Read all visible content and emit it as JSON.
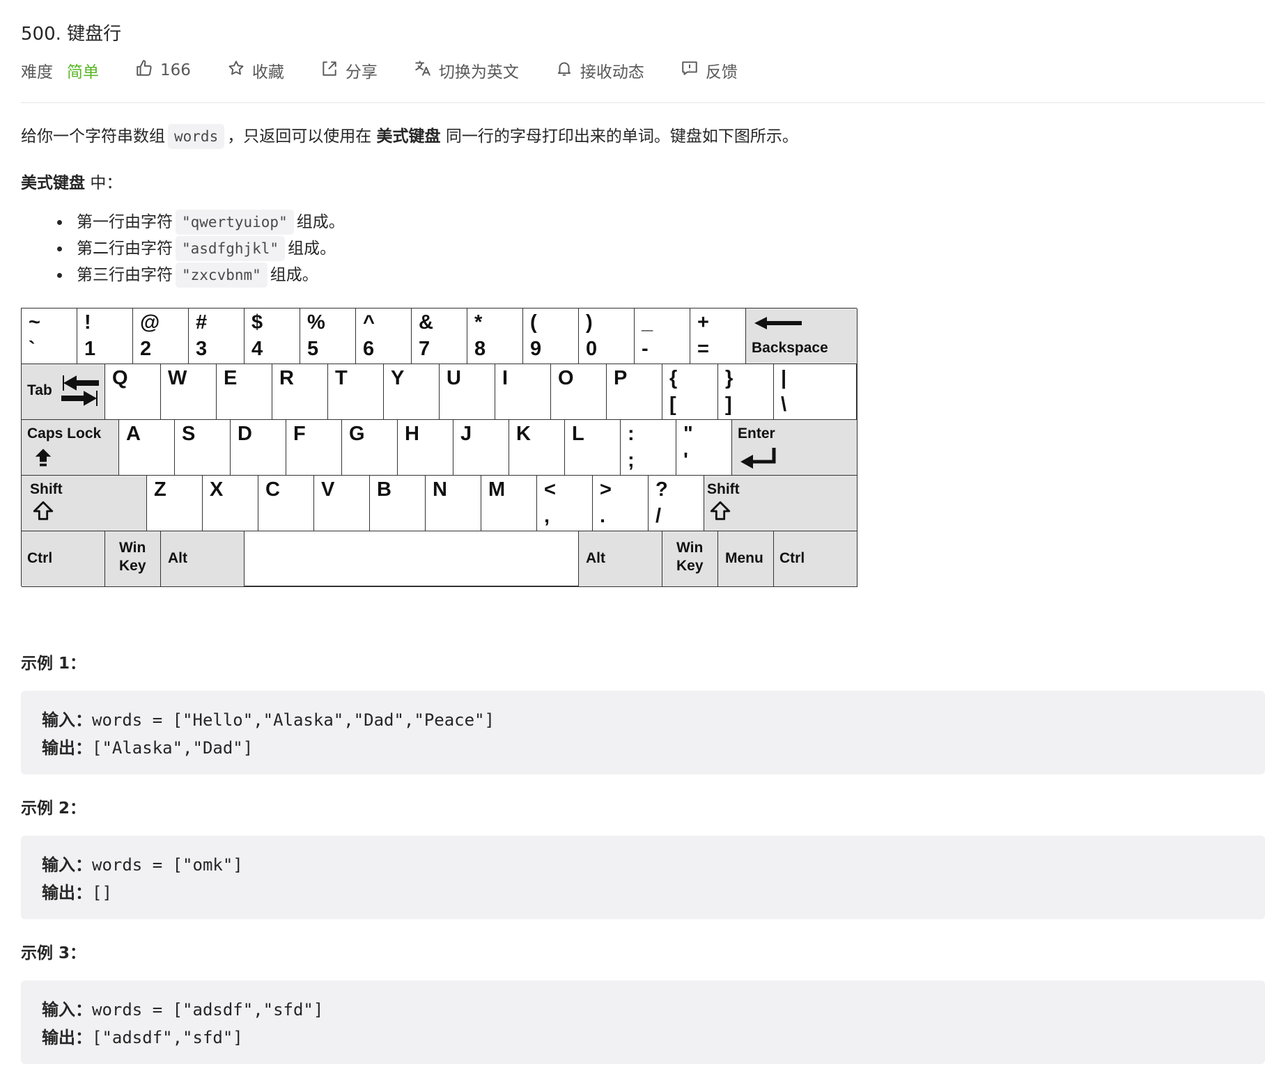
{
  "problem": {
    "title": "500. 键盘行",
    "difficulty_label": "难度",
    "difficulty_value": "简单",
    "likes": "166",
    "favorite_label": "收藏",
    "share_label": "分享",
    "switch_lang_label": "切换为英文",
    "subscribe_label": "接收动态",
    "feedback_label": "反馈"
  },
  "description": {
    "intro_part1": "给你一个字符串数组",
    "intro_code": "words",
    "intro_part2": "，只返回可以使用在",
    "intro_bold": "美式键盘",
    "intro_part3": "同一行的字母打印出来的单词。键盘如下图所示。",
    "subhead_bold": "美式键盘",
    "subhead_rest": "中：",
    "rows": [
      {
        "prefix": "第一行由字符",
        "code": "\"qwertyuiop\"",
        "suffix": "组成。"
      },
      {
        "prefix": "第二行由字符",
        "code": "\"asdfghjkl\"",
        "suffix": "组成。"
      },
      {
        "prefix": "第三行由字符",
        "code": "\"zxcvbnm\"",
        "suffix": "组成。"
      }
    ]
  },
  "keyboard": {
    "row1": [
      [
        "~",
        "`"
      ],
      [
        "!",
        "1"
      ],
      [
        "@",
        "2"
      ],
      [
        "#",
        "3"
      ],
      [
        "$",
        "4"
      ],
      [
        "%",
        "5"
      ],
      [
        "^",
        "6"
      ],
      [
        "&",
        "7"
      ],
      [
        "*",
        "8"
      ],
      [
        "(",
        "9"
      ],
      [
        ")",
        "0"
      ],
      [
        "_",
        "-"
      ],
      [
        "+",
        "="
      ]
    ],
    "backspace": "Backspace",
    "tab": "Tab",
    "row2": [
      "Q",
      "W",
      "E",
      "R",
      "T",
      "Y",
      "U",
      "I",
      "O",
      "P"
    ],
    "row2_sym": [
      [
        "{",
        "["
      ],
      [
        "}",
        "]"
      ],
      [
        "|",
        "\\"
      ]
    ],
    "caps": "Caps Lock",
    "row3": [
      "A",
      "S",
      "D",
      "F",
      "G",
      "H",
      "J",
      "K",
      "L"
    ],
    "row3_sym": [
      [
        ":",
        ";"
      ],
      [
        "\"",
        "'"
      ]
    ],
    "enter": "Enter",
    "shift": "Shift",
    "row4": [
      "Z",
      "X",
      "C",
      "V",
      "B",
      "N",
      "M"
    ],
    "row4_sym": [
      [
        "<",
        ","
      ],
      [
        ">",
        "."
      ],
      [
        "?",
        "/"
      ]
    ],
    "ctrl": "Ctrl",
    "win_top": "Win",
    "win_bottom": "Key",
    "alt": "Alt",
    "menu": "Menu"
  },
  "examples": [
    {
      "title": "示例 1：",
      "input_label": "输入：",
      "input": "words = [\"Hello\",\"Alaska\",\"Dad\",\"Peace\"]",
      "output_label": "输出：",
      "output": "[\"Alaska\",\"Dad\"]"
    },
    {
      "title": "示例 2：",
      "input_label": "输入：",
      "input": "words = [\"omk\"]",
      "output_label": "输出：",
      "output": "[]"
    },
    {
      "title": "示例 3：",
      "input_label": "输入：",
      "input": "words = [\"adsdf\",\"sfd\"]",
      "output_label": "输出：",
      "output": "[\"adsdf\",\"sfd\"]"
    }
  ],
  "colors": {
    "difficulty": "#5ab726",
    "code_bg": "#f2f2f4",
    "pre_bg": "#f1f1f3",
    "key_gray": "#e1e1e1"
  }
}
